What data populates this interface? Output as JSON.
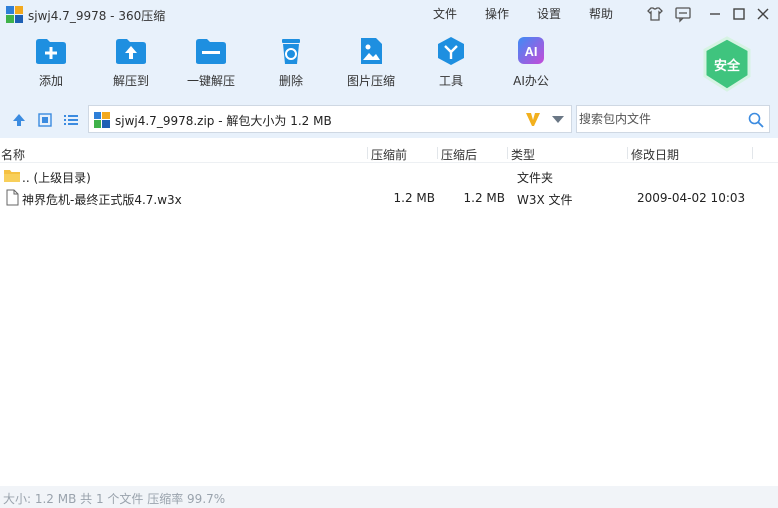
{
  "window": {
    "title": "sjwj4.7_9978 - 360压缩",
    "menu": [
      "文件",
      "操作",
      "设置",
      "帮助"
    ]
  },
  "toolbar": {
    "items": [
      {
        "label": "添加",
        "icon": "add-icon"
      },
      {
        "label": "解压到",
        "icon": "extract-to-icon"
      },
      {
        "label": "一键解压",
        "icon": "one-click-extract-icon"
      },
      {
        "label": "删除",
        "icon": "delete-icon"
      },
      {
        "label": "图片压缩",
        "icon": "image-compress-icon"
      },
      {
        "label": "工具",
        "icon": "tools-icon"
      },
      {
        "label": "AI办公",
        "icon": "ai-office-icon"
      }
    ],
    "security_badge": "安全",
    "accent_color": "#1e8fe0",
    "badge_color": "#3fc47e"
  },
  "address": {
    "path": "sjwj4.7_9978.zip - 解包大小为 1.2 MB",
    "search_placeholder": "搜索包内文件"
  },
  "table": {
    "columns": [
      "名称",
      "压缩前",
      "压缩后",
      "类型",
      "修改日期"
    ],
    "rows": [
      {
        "name": ".. (上级目录)",
        "before": "",
        "after": "",
        "type": "文件夹",
        "date": "",
        "icon": "folder-icon"
      },
      {
        "name": "神界危机-最终正式版4.7.w3x",
        "before": "1.2 MB",
        "after": "1.2 MB",
        "type": "W3X 文件",
        "date": "2009-04-02 10:03",
        "icon": "file-icon"
      }
    ]
  },
  "status": {
    "text": "大小: 1.2 MB 共 1 个文件 压缩率 99.7%"
  }
}
